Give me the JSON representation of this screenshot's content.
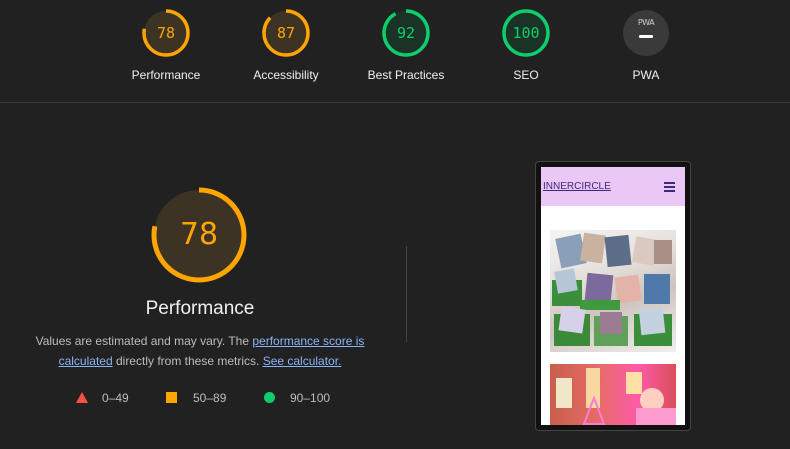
{
  "categories": [
    {
      "label": "Performance",
      "score": "78",
      "status": "average"
    },
    {
      "label": "Accessibility",
      "score": "87",
      "status": "average"
    },
    {
      "label": "Best Practices",
      "score": "92",
      "status": "pass"
    },
    {
      "label": "SEO",
      "score": "100",
      "status": "pass"
    },
    {
      "label": "PWA",
      "badge": "PWA",
      "score": "—",
      "status": "na"
    }
  ],
  "main": {
    "score": "78",
    "title": "Performance",
    "description_prefix": "Values are estimated and may vary. The ",
    "link1": "performance score is calculated",
    "description_mid": " directly from these metrics. ",
    "link2": "See calculator."
  },
  "legend": [
    {
      "shape": "triangle",
      "range": "0–49",
      "color": "#ff4e42"
    },
    {
      "shape": "square",
      "range": "50–89",
      "color": "#ffa400"
    },
    {
      "shape": "circle",
      "range": "90–100",
      "color": "#0cce6b"
    }
  ],
  "screenshot": {
    "site_logo": "INNERCIRCLE",
    "header_color": "#ebc7f5"
  },
  "colors": {
    "average": "#ffa400",
    "pass": "#0cce6b",
    "fail": "#ff4e42",
    "background": "#212121"
  }
}
